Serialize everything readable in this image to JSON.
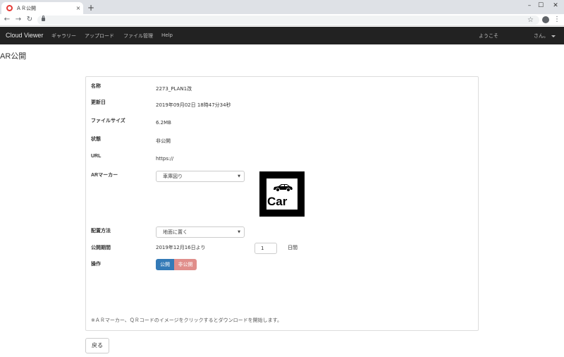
{
  "browser": {
    "tab_title": "ＡＲ公開",
    "tab_close": "×",
    "new_tab": "+",
    "window_controls": [
      "–",
      "☐",
      "✕"
    ]
  },
  "navbar": {
    "brand": "Cloud Viewer",
    "items": [
      "ギャラリー",
      "アップロード",
      "ファイル管理",
      "Help"
    ],
    "welcome": "ようこそ",
    "user": "さん。"
  },
  "page": {
    "title": "AR公開",
    "fields": {
      "name_label": "名称",
      "name_value": "2273_PLAN1改",
      "updated_label": "更新日",
      "updated_value": "2019年09月02日 18時47分34秒",
      "size_label": "ファイルサイズ",
      "size_value": "6.2MB",
      "status_label": "状態",
      "status_value": "非公開",
      "url_label": "URL",
      "url_value": "https://",
      "marker_label": "ARマーカー",
      "marker_select": "車庫図り",
      "marker_text": "Car",
      "placement_label": "配置方法",
      "placement_select": "地面に置く",
      "period_label": "公開期間",
      "period_value": "2019年12月16日より",
      "period_days": "1",
      "period_unit": "日間",
      "action_label": "操作",
      "publish_button": "公開",
      "unpublish_button": "非公開"
    },
    "note": "※ＡＲマーカー、ＱＲコードのイメージをクリックするとダウンロードを開始します。",
    "back_button": "戻る"
  },
  "colors": {
    "navbar_bg": "#222222",
    "publish": "#337ab7",
    "unpublish": "#e08e8b"
  }
}
